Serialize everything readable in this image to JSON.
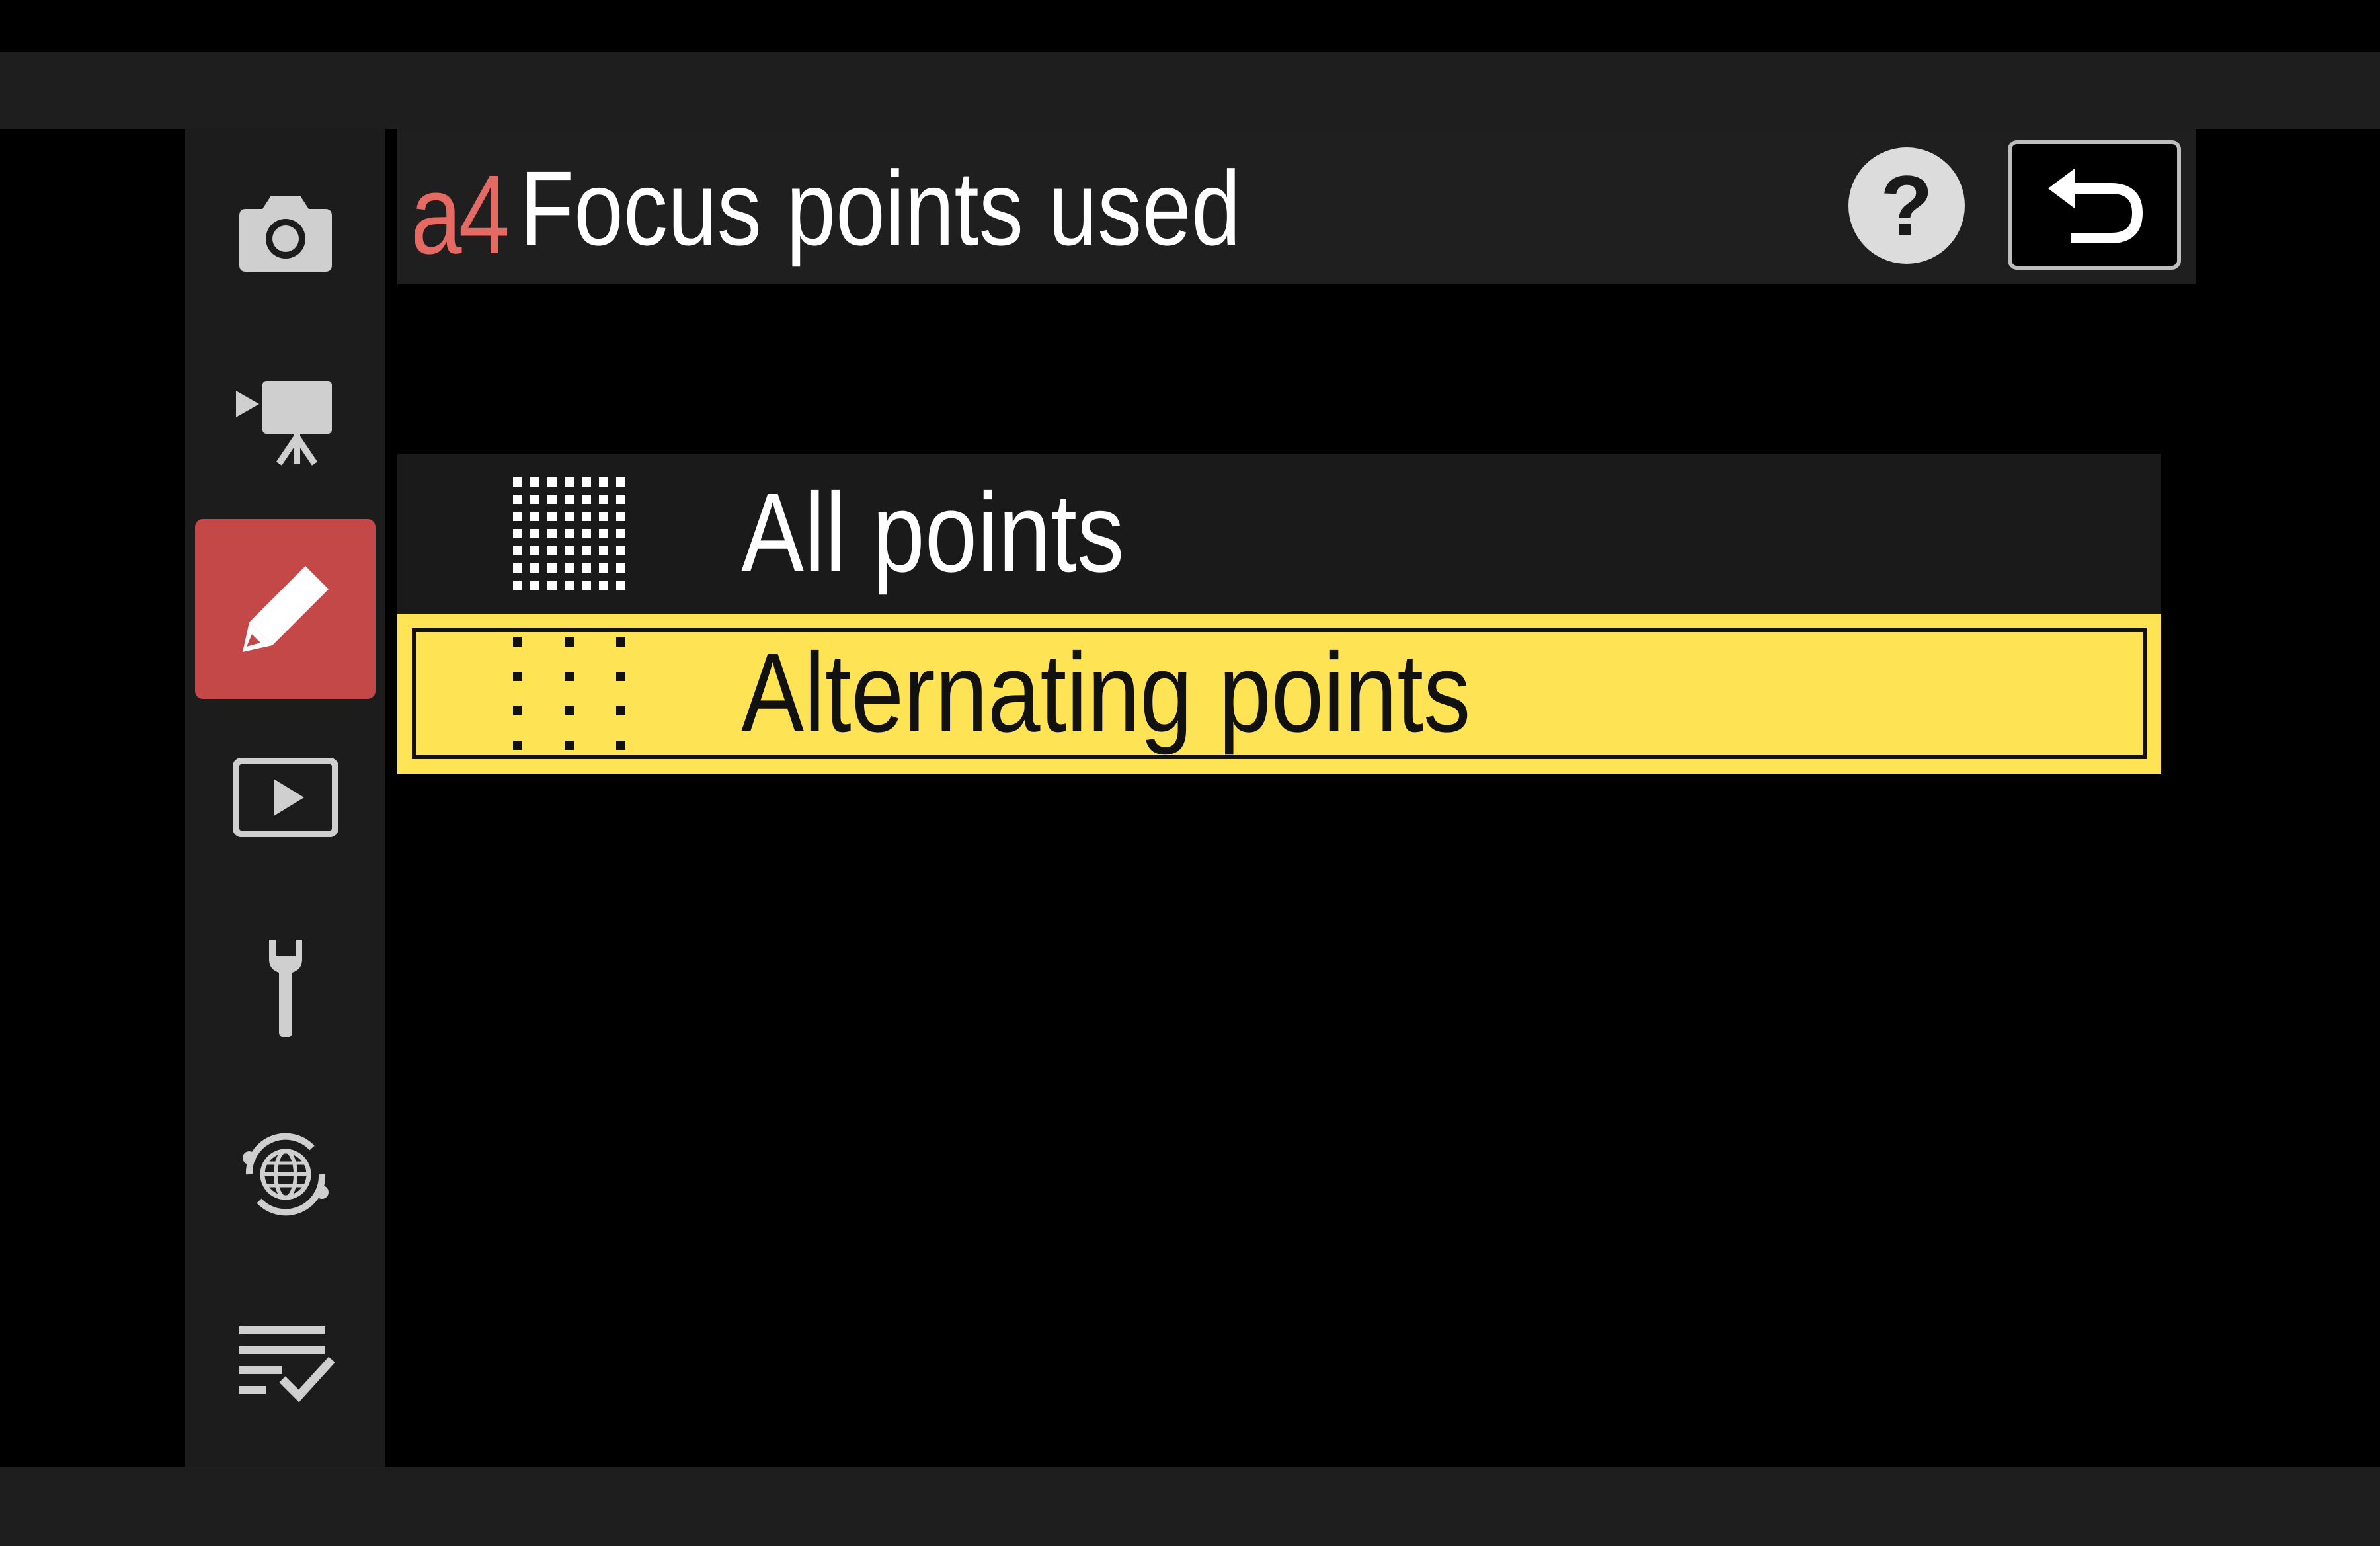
{
  "header": {
    "code": "a4",
    "title": "Focus points used",
    "help_label": "?"
  },
  "sidebar": {
    "items": [
      {
        "icon": "camera-icon",
        "active": false
      },
      {
        "icon": "movie-camera-icon",
        "active": false
      },
      {
        "icon": "pencil-icon",
        "active": true
      },
      {
        "icon": "playback-icon",
        "active": false
      },
      {
        "icon": "wrench-icon",
        "active": false
      },
      {
        "icon": "network-icon",
        "active": false
      },
      {
        "icon": "my-menu-icon",
        "active": false
      }
    ]
  },
  "options": [
    {
      "label": "All points",
      "icon": "all-points-grid-icon",
      "selected": false
    },
    {
      "label": "Alternating points",
      "icon": "alternating-points-grid-icon",
      "selected": true
    }
  ],
  "colors": {
    "accent_red": "#c54848",
    "code_red": "#e46a63",
    "highlight_yellow": "#fee355"
  }
}
